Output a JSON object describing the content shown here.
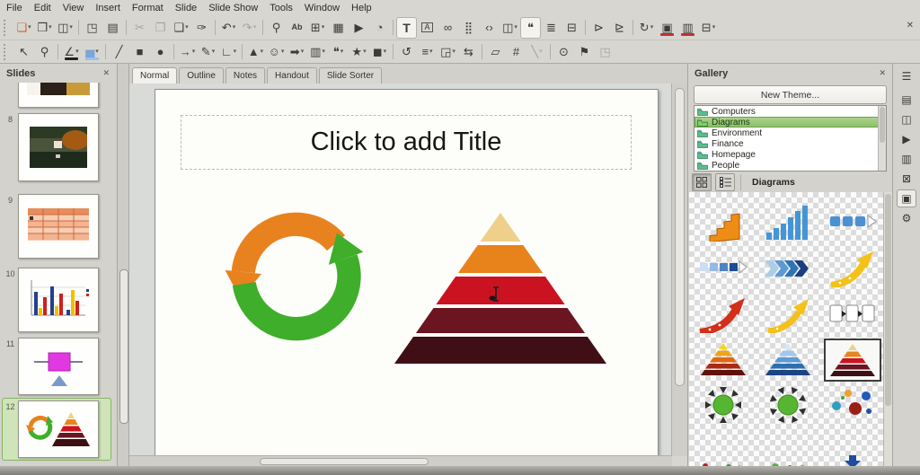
{
  "icons": {
    "close": "✕",
    "dropdown": "▾"
  },
  "menubar": {
    "items": [
      "File",
      "Edit",
      "View",
      "Insert",
      "Format",
      "Slide",
      "Slide Show",
      "Tools",
      "Window",
      "Help"
    ]
  },
  "toolbars": {
    "standard": [
      {
        "n": "new-presentation",
        "g": "❏",
        "c": "#d2622e",
        "dd": true
      },
      {
        "n": "open-document",
        "g": "❒",
        "dd": true
      },
      {
        "n": "save",
        "g": "◫",
        "dd": true
      },
      {
        "sep": true
      },
      {
        "n": "export-pdf",
        "g": "◳"
      },
      {
        "n": "print",
        "g": "▤"
      },
      {
        "sep": true
      },
      {
        "n": "cut",
        "g": "✂",
        "dis": true
      },
      {
        "n": "copy",
        "g": "❐",
        "dis": true
      },
      {
        "n": "paste",
        "g": "❑",
        "dd": true
      },
      {
        "n": "clone-formatting",
        "g": "✑"
      },
      {
        "sep": true
      },
      {
        "n": "undo",
        "g": "↶",
        "dd": true
      },
      {
        "n": "redo",
        "g": "↷",
        "dd": true,
        "dis": true
      },
      {
        "sep": true
      },
      {
        "n": "find-replace",
        "g": "⚲"
      },
      {
        "n": "spelling",
        "g": "Ab",
        "small": true
      },
      {
        "n": "insert-table",
        "g": "⊞",
        "dd": true
      },
      {
        "n": "insert-image",
        "g": "▦"
      },
      {
        "n": "insert-media",
        "g": "▶"
      },
      {
        "n": "insert-chart",
        "g": "◔"
      },
      {
        "sep": true
      },
      {
        "n": "insert-text-box",
        "g": "T",
        "on": true,
        "bold": true
      },
      {
        "n": "vertical-text",
        "g": "A",
        "boxed": true
      },
      {
        "n": "insert-hyperlink",
        "g": "∞"
      },
      {
        "n": "display-grid",
        "g": "⣿"
      },
      {
        "n": "special-character",
        "g": "‹›"
      },
      {
        "n": "display-views",
        "g": "◫",
        "dd": true
      },
      {
        "n": "insert-comment",
        "g": "❝",
        "on": true
      },
      {
        "n": "outline-view",
        "g": "≣"
      },
      {
        "n": "master-view",
        "g": "⊟"
      },
      {
        "sep": true
      },
      {
        "n": "start-from-first-slide",
        "g": "⊳"
      },
      {
        "n": "start-from-current-slide",
        "g": "⊵"
      },
      {
        "sep": true
      },
      {
        "n": "rotate",
        "g": "↻",
        "dd": true
      },
      {
        "n": "duplicate-slide",
        "g": "▣",
        "bar": "#c03030"
      },
      {
        "n": "new-slide",
        "g": "▥",
        "bar": "#c03030"
      },
      {
        "n": "expand-slide",
        "g": "⊟",
        "dd": true
      }
    ],
    "drawing": [
      {
        "n": "select",
        "g": "↖"
      },
      {
        "n": "zoom-pan",
        "g": "⚲"
      },
      {
        "sep": true
      },
      {
        "n": "line-color",
        "g": "∠",
        "dd": true,
        "bar": "#222222"
      },
      {
        "n": "fill-color",
        "g": "▅",
        "c": "#7aa6d8",
        "dd": true,
        "bar": "#9cc0e8"
      },
      {
        "sep": true
      },
      {
        "n": "insert-line",
        "g": "╱"
      },
      {
        "n": "rectangle",
        "g": "■"
      },
      {
        "n": "ellipse",
        "g": "●"
      },
      {
        "sep": true
      },
      {
        "n": "lines-and-arrows",
        "g": "→",
        "dd": true
      },
      {
        "n": "curves-polygons",
        "g": "✎",
        "dd": true
      },
      {
        "n": "connectors",
        "g": "∟",
        "dd": true
      },
      {
        "sep": true
      },
      {
        "n": "basic-shapes",
        "g": "▲",
        "dd": true
      },
      {
        "n": "symbol-shapes",
        "g": "☺",
        "dd": true
      },
      {
        "n": "block-arrows",
        "g": "➡",
        "dd": true
      },
      {
        "n": "flowchart-shapes",
        "g": "▥",
        "dd": true
      },
      {
        "n": "callout-shapes",
        "g": "❝",
        "dd": true
      },
      {
        "n": "star-shapes",
        "g": "★",
        "dd": true
      },
      {
        "n": "3d-objects",
        "g": "◼",
        "dd": true
      },
      {
        "sep": true
      },
      {
        "n": "rotate-object",
        "g": "↺"
      },
      {
        "n": "align-objects",
        "g": "≡",
        "dd": true
      },
      {
        "n": "arrange-objects",
        "g": "◲",
        "dd": true
      },
      {
        "n": "distribute",
        "g": "⇆"
      },
      {
        "sep": true
      },
      {
        "n": "shadow",
        "g": "▱"
      },
      {
        "n": "crop-image",
        "g": "#"
      },
      {
        "n": "image-filter",
        "g": "╲",
        "dd": true,
        "dis": true
      },
      {
        "sep": true
      },
      {
        "n": "edit-points",
        "g": "⊙"
      },
      {
        "n": "glue-points",
        "g": "⚑"
      },
      {
        "n": "to-3d",
        "g": "◳",
        "dis": true
      }
    ]
  },
  "slides_panel": {
    "title": "Slides",
    "slides": [
      {
        "number": ""
      },
      {
        "number": "8"
      },
      {
        "number": "9"
      },
      {
        "number": "10"
      },
      {
        "number": "11"
      },
      {
        "number": "12",
        "selected": true
      }
    ]
  },
  "view_tabs": {
    "items": [
      "Normal",
      "Outline",
      "Notes",
      "Handout",
      "Slide Sorter"
    ],
    "active": "Normal"
  },
  "canvas": {
    "title_placeholder": "Click to add Title"
  },
  "gallery": {
    "title": "Gallery",
    "new_theme_button": "New Theme...",
    "themes": [
      {
        "label": "Computers"
      },
      {
        "label": "Diagrams",
        "selected": true
      },
      {
        "label": "Environment"
      },
      {
        "label": "Finance"
      },
      {
        "label": "Homepage"
      },
      {
        "label": "People"
      }
    ],
    "current_theme_label": "Diagrams",
    "items": [
      "orange-3d-steps",
      "blue-bar-chart",
      "blue-squares-arrow",
      "fading-squares-arrow",
      "blue-chevron-arrows",
      "yellow-curved-arrow",
      "red-curved-arrow",
      "yellow-curved-arrow-2",
      "process-boxes-arrows",
      "orange-pyramid",
      "blue-pyramid",
      "red-pyramid-selected",
      "green-circle-arrows-in",
      "green-circle-arrows-in-2",
      "scattered-spheres",
      "dots-row-partial",
      "green-dots-partial",
      "arrow-down-partial"
    ]
  },
  "sidebar_tabs": [
    {
      "name": "sidebar-settings",
      "glyph": "☰"
    },
    {
      "name": "properties",
      "glyph": "▤"
    },
    {
      "name": "slide-transition",
      "glyph": "◫"
    },
    {
      "name": "animation",
      "glyph": "▶"
    },
    {
      "name": "master-slides",
      "glyph": "▥"
    },
    {
      "name": "styles",
      "glyph": "⊠"
    },
    {
      "name": "gallery",
      "glyph": "▣",
      "active": true
    },
    {
      "name": "navigator",
      "glyph": "⚙"
    }
  ]
}
